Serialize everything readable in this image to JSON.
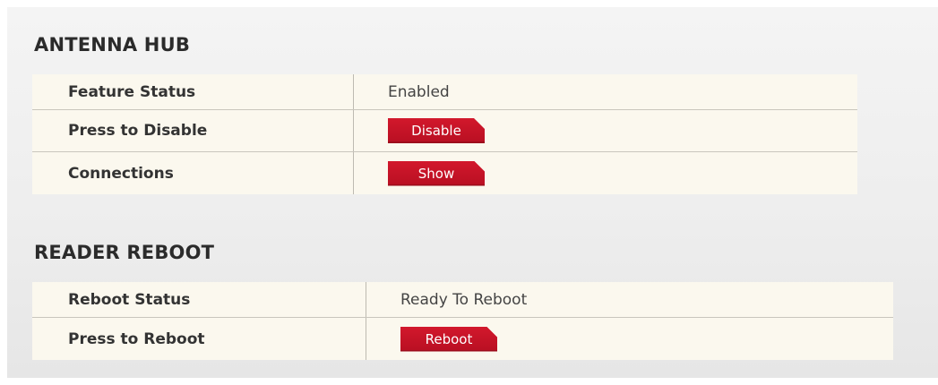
{
  "antenna_hub": {
    "title": "ANTENNA HUB",
    "rows": [
      {
        "label": "Feature Status",
        "value": "Enabled"
      },
      {
        "label": "Press to Disable",
        "button": "Disable"
      },
      {
        "label": "Connections",
        "button": "Show"
      }
    ]
  },
  "reader_reboot": {
    "title": "READER REBOOT",
    "rows": [
      {
        "label": "Reboot Status",
        "value": "Ready To Reboot"
      },
      {
        "label": "Press to Reboot",
        "button": "Reboot"
      }
    ]
  },
  "colors": {
    "button": "#c8102e",
    "row_background": "#fbf8ee",
    "panel_background": "#eeeeee"
  }
}
